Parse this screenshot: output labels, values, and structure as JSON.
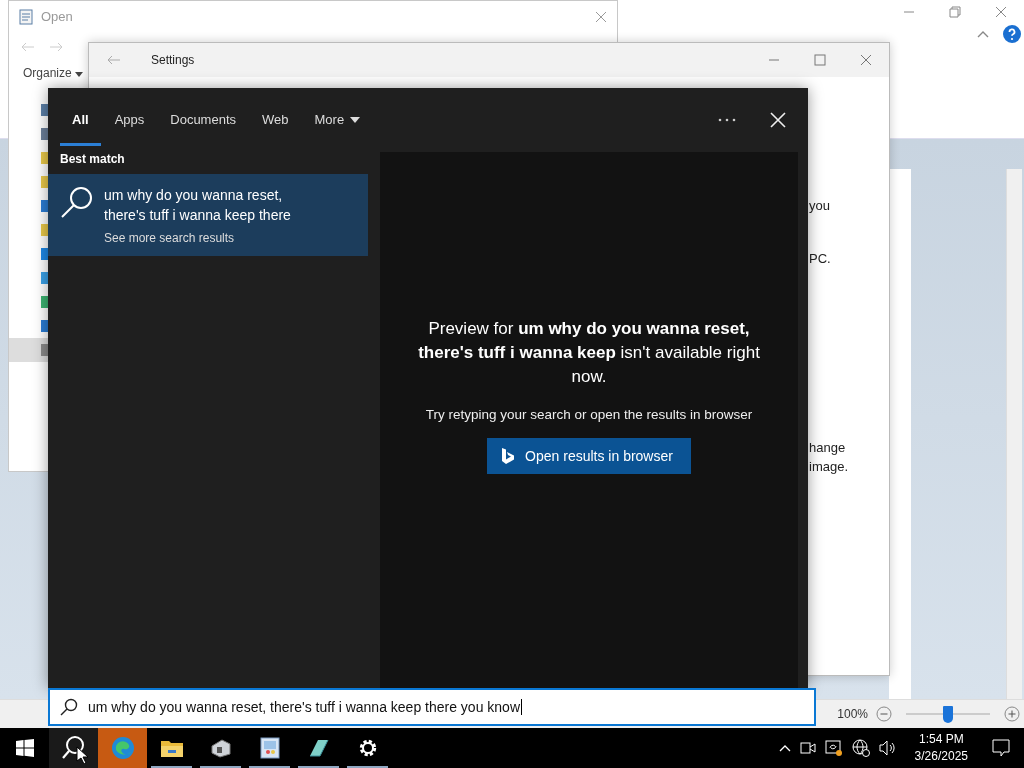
{
  "background_app": {
    "zoom": {
      "reading": "100%",
      "level": 0.5
    }
  },
  "open_dialog": {
    "title": "Open",
    "organize": "Organize"
  },
  "settings_window": {
    "title": "Settings",
    "fragments": [
      "you",
      "PC.",
      "hange",
      "image."
    ]
  },
  "search": {
    "tabs": [
      {
        "label": "All",
        "kind": "tab",
        "selected": true
      },
      {
        "label": "Apps",
        "kind": "tab",
        "selected": false
      },
      {
        "label": "Documents",
        "kind": "tab",
        "selected": false
      },
      {
        "label": "Web",
        "kind": "tab",
        "selected": false
      },
      {
        "label": "More",
        "kind": "dropdown",
        "selected": false
      }
    ],
    "section": "Best match",
    "result": {
      "title": "um why do you wanna reset, there's tuff i wanna keep there",
      "subtitle": "See more search results",
      "selected": true
    },
    "preview": {
      "message": "Preview for **um why do you wanna reset, there's tuff i wanna keep** isn't available right now.",
      "hint": "Try retyping your search or open the results in browser",
      "button": "Open results in browser"
    },
    "query": "um why do you wanna reset, there's tuff i wanna keep there you know"
  },
  "taskbar": {
    "apps": [
      {
        "kind": "start",
        "highlighted": false,
        "running": false
      },
      {
        "kind": "search",
        "highlighted": true,
        "running": false
      },
      {
        "kind": "browser",
        "highlighted": true,
        "running": false
      },
      {
        "kind": "explorer",
        "highlighted": false,
        "running": true
      },
      {
        "kind": "scanner",
        "highlighted": false,
        "running": true
      },
      {
        "kind": "paint",
        "highlighted": false,
        "running": true
      },
      {
        "kind": "notepad",
        "highlighted": false,
        "running": true
      },
      {
        "kind": "settings",
        "highlighted": false,
        "running": true
      }
    ],
    "clock": {
      "time": "1:54 PM",
      "date": "3/26/2025"
    }
  }
}
